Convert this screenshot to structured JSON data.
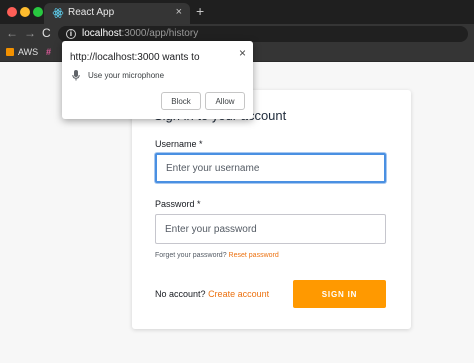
{
  "browser": {
    "tab": {
      "title": "React App",
      "close": "×"
    },
    "new_tab": "+",
    "nav": {
      "back": "←",
      "forward": "→",
      "reload": "C"
    },
    "url": {
      "host": "localhost",
      "rest": ":3000/app/history"
    },
    "bookmarks": [
      {
        "label": "AWS"
      },
      {
        "label": "#"
      }
    ]
  },
  "permission_popup": {
    "title": "http://localhost:3000 wants to",
    "close": "×",
    "permission": "Use your microphone",
    "block_label": "Block",
    "allow_label": "Allow"
  },
  "signin_form": {
    "title": "Sign in to your account",
    "username_label": "Username *",
    "username_placeholder": "Enter your username",
    "password_label": "Password *",
    "password_placeholder": "Enter your password",
    "forgot_text": "Forget your password?",
    "reset_link": "Reset password",
    "no_account_text": "No account?",
    "create_link": "Create account",
    "signin_label": "SIGN IN"
  },
  "colors": {
    "accent": "#ff9900",
    "link": "#ec7211",
    "focus": "#4a90e2"
  }
}
